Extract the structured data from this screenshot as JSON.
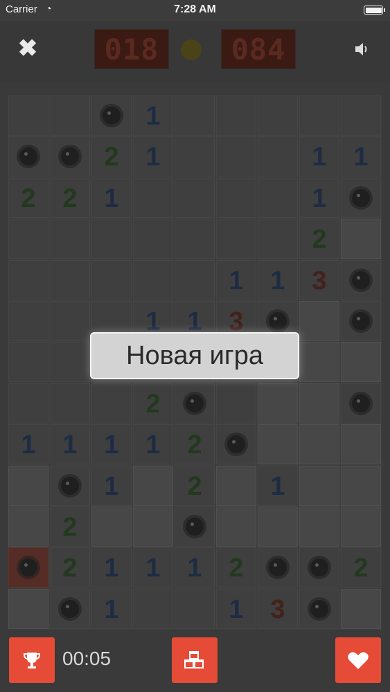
{
  "status_bar": {
    "carrier": "Carrier",
    "time": "7:28 AM"
  },
  "header": {
    "mine_counter": "018",
    "time_counter": "084"
  },
  "board": {
    "cols": 9,
    "rows": 13,
    "cells": [
      [
        "",
        "",
        "M",
        "1",
        "",
        "",
        "",
        "",
        ""
      ],
      [
        "M",
        "M",
        "2",
        "1",
        "",
        "",
        "",
        "1",
        "1"
      ],
      [
        "2",
        "2",
        "1",
        "",
        "",
        "",
        "",
        "1",
        "M"
      ],
      [
        "",
        "",
        "",
        "",
        "",
        "",
        "",
        "2",
        "H"
      ],
      [
        "",
        "",
        "",
        "",
        "",
        "1",
        "1",
        "3",
        "M"
      ],
      [
        "",
        "",
        "",
        "1",
        "1",
        "3",
        "M",
        "H",
        "M"
      ],
      [
        "",
        "",
        "",
        "",
        "",
        "",
        "",
        "H",
        "H"
      ],
      [
        "",
        "",
        "",
        "2",
        "M",
        "",
        "H",
        "H",
        "M"
      ],
      [
        "1",
        "1",
        "1",
        "1",
        "2",
        "M",
        "H",
        "H",
        "H"
      ],
      [
        "H",
        "M",
        "1",
        "H",
        "2",
        "H",
        "1",
        "H",
        "H"
      ],
      [
        "H",
        "2",
        "H",
        "H",
        "M",
        "H",
        "H",
        "H",
        "H"
      ],
      [
        "X",
        "2",
        "1",
        "1",
        "1",
        "2",
        "M",
        "M",
        "2"
      ],
      [
        "H",
        "M",
        "1",
        "",
        "",
        "1",
        "3",
        "M",
        "H"
      ]
    ]
  },
  "dialog": {
    "new_game_label": "Новая игра"
  },
  "footer": {
    "timer": "00:05"
  },
  "icons": {
    "close": "close-icon",
    "sound": "speaker-icon",
    "trophy": "trophy-icon",
    "cubes": "cubes-icon",
    "heart": "heart-icon"
  },
  "colors": {
    "accent": "#e54b37",
    "background": "#3a3a3a"
  }
}
